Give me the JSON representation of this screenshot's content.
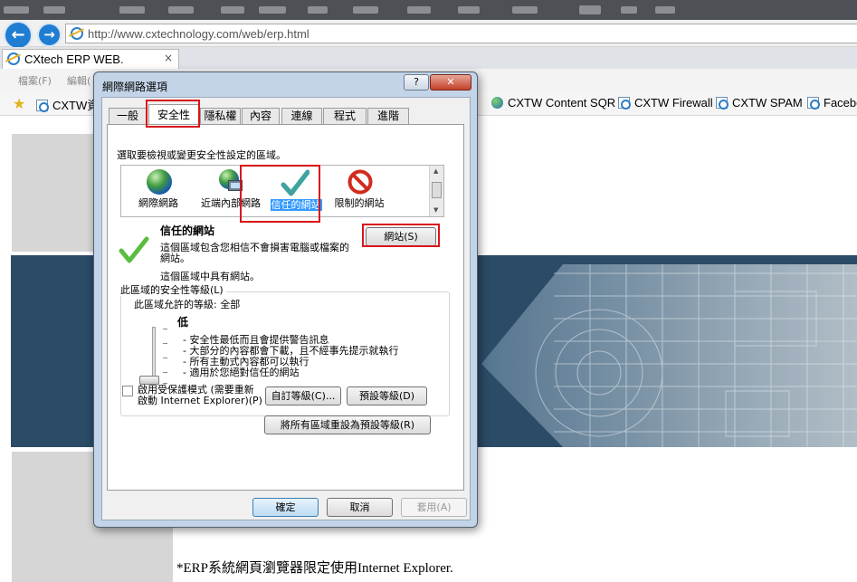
{
  "browser": {
    "address_url": "http://www.cxtechnology.com/web/erp.html",
    "tab_title": "CXtech ERP WEB.",
    "tab_close": "×",
    "menu_items": [
      "檔案(F)",
      "編輯("
    ],
    "favorites": [
      {
        "label": "CXTW資",
        "icon": "ie-page-icon"
      },
      {
        "label": "CXTW Content SQR",
        "icon": "globe-icon"
      },
      {
        "label": "CXTW Firewall",
        "icon": "ie-page-icon"
      },
      {
        "label": "CXTW SPAM",
        "icon": "ie-page-icon"
      },
      {
        "label": "Facebo",
        "icon": "ie-page-icon"
      }
    ]
  },
  "page": {
    "footnote": "*ERP系統網頁瀏覽器限定使用Internet Explorer."
  },
  "dialog": {
    "title": "網際網路選項",
    "help_glyph": "?",
    "close_glyph": "✕",
    "tabs": [
      "一般",
      "安全性",
      "隱私權",
      "內容",
      "連線",
      "程式",
      "進階"
    ],
    "active_tab": "安全性",
    "zone_prompt": "選取要檢視或變更安全性設定的區域。",
    "zones": [
      {
        "label": "網際網路",
        "icon": "globe-icon"
      },
      {
        "label": "近端內部網路",
        "icon": "intranet-icon"
      },
      {
        "label": "信任的網站",
        "icon": "checkmark-icon",
        "selected": true
      },
      {
        "label": "限制的網站",
        "icon": "no-entry-icon"
      }
    ],
    "zone_detail": {
      "title": "信任的網站",
      "description_line1": "這個區域包含您相信不會損害電腦或檔案的",
      "description_line2": "網站。",
      "sites_note": "這個區域中具有網站。",
      "sites_button": "網站(S)"
    },
    "security_level": {
      "group_label": "此區域的安全性等級(L)",
      "allowed_levels": "此區域允許的等級: 全部",
      "level_name": "低",
      "level_position": 0,
      "bullets": [
        "- 安全性最低而且會提供警告訊息",
        "- 大部分的內容都會下載，且不經事先提示就執行",
        "- 所有主動式內容都可以執行",
        "- 適用於您絕對信任的網站"
      ]
    },
    "protected_mode": {
      "label_line1": "啟用受保護模式 (需要重新",
      "label_line2": "啟動 Internet Explorer)(P)",
      "checked": false
    },
    "buttons": {
      "custom_level": "自訂等級(C)...",
      "default_level": "預設等級(D)",
      "reset_all": "將所有區域重設為預設等級(R)",
      "ok": "確定",
      "cancel": "取消",
      "apply": "套用(A)"
    }
  }
}
